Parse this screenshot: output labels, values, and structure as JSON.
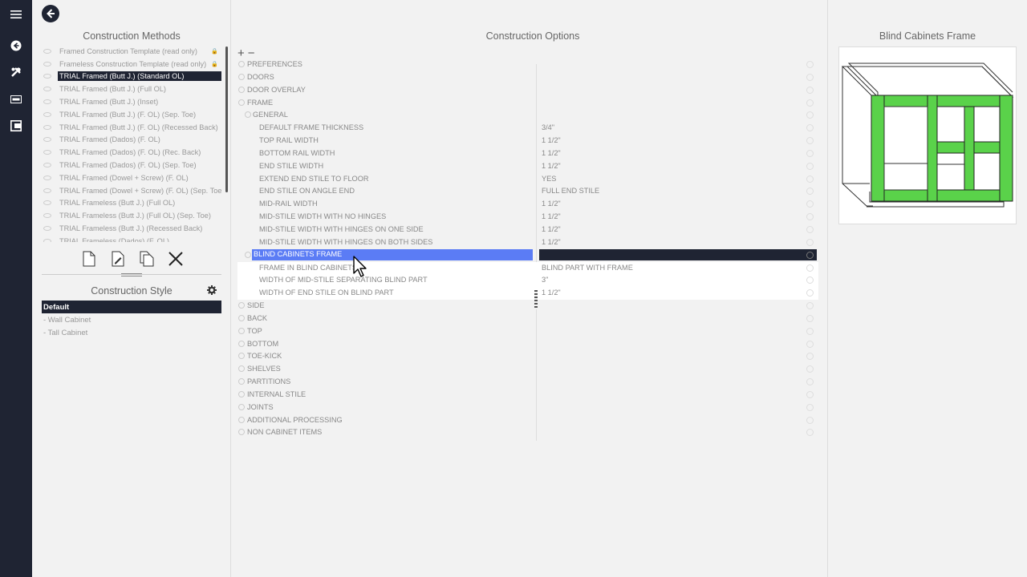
{
  "nav_rail": {
    "icons": [
      "menu-icon",
      "back-circle-icon",
      "tools-icon",
      "panel-icon",
      "cabinet-icon"
    ]
  },
  "left_panel": {
    "title": "Construction Methods",
    "methods": [
      {
        "label": "Framed Construction Template (read only)",
        "locked": true
      },
      {
        "label": "Frameless Construction Template (read only)",
        "locked": true
      },
      {
        "label": "TRIAL Framed (Butt J.) (Standard OL)",
        "selected": true
      },
      {
        "label": "TRIAL Framed (Butt J.) (Full OL)"
      },
      {
        "label": "TRIAL Framed (Butt J.) (Inset)"
      },
      {
        "label": "TRIAL Framed (Butt J.) (F. OL) (Sep. Toe)"
      },
      {
        "label": "TRIAL Framed (Butt J.) (F. OL) (Recessed Back)"
      },
      {
        "label": "TRIAL Framed (Dados) (F. OL)"
      },
      {
        "label": "TRIAL Framed (Dados) (F. OL) (Rec. Back)"
      },
      {
        "label": "TRIAL Framed (Dados) (F. OL) (Sep. Toe)"
      },
      {
        "label": "TRIAL Framed (Dowel + Screw) (F. OL)"
      },
      {
        "label": "TRIAL Framed (Dowel + Screw) (F. OL) (Sep. Toe)"
      },
      {
        "label": "TRIAL Frameless (Butt J.) (Full OL)"
      },
      {
        "label": "TRIAL Frameless (Butt J.) (Full OL) (Sep. Toe)"
      },
      {
        "label": "TRIAL Frameless (Butt J.) (Recessed Back)"
      },
      {
        "label": "TRIAL Frameless (Dados) (F. OL)"
      }
    ],
    "style_title": "Construction Style",
    "styles": [
      {
        "label": "Default",
        "selected": true
      },
      {
        "label": "- Wall Cabinet"
      },
      {
        "label": "- Tall Cabinet"
      }
    ]
  },
  "mid_panel": {
    "title": "Construction Options",
    "plus": "+",
    "minus": "−",
    "rows": [
      {
        "name": "PREFERENCES",
        "level": 0
      },
      {
        "name": "DOORS",
        "level": 0
      },
      {
        "name": "DOOR OVERLAY",
        "level": 0
      },
      {
        "name": "FRAME",
        "level": 0
      },
      {
        "name": "GENERAL",
        "level": 1
      },
      {
        "name": "DEFAULT FRAME THICKNESS",
        "level": 2,
        "value": "3/4\""
      },
      {
        "name": "TOP RAIL WIDTH",
        "level": 2,
        "value": "1 1/2\""
      },
      {
        "name": "BOTTOM RAIL WIDTH",
        "level": 2,
        "value": "1 1/2\""
      },
      {
        "name": "END STILE WIDTH",
        "level": 2,
        "value": "1 1/2\""
      },
      {
        "name": "EXTEND END STILE TO FLOOR",
        "level": 2,
        "value": "YES"
      },
      {
        "name": "END STILE ON ANGLE END",
        "level": 2,
        "value": "FULL END STILE"
      },
      {
        "name": "MID-RAIL WIDTH",
        "level": 2,
        "value": "1 1/2\""
      },
      {
        "name": "MID-STILE WIDTH WITH NO HINGES",
        "level": 2,
        "value": "1 1/2\""
      },
      {
        "name": "MID-STILE WIDTH WITH HINGES ON ONE SIDE",
        "level": 2,
        "value": "1 1/2\""
      },
      {
        "name": "MID-STILE WIDTH WITH HINGES ON BOTH SIDES",
        "level": 2,
        "value": "1 1/2\""
      },
      {
        "name": "BLIND CABINETS FRAME",
        "level": 1,
        "selected": true
      },
      {
        "name": "FRAME IN BLIND CABINETS",
        "level": 2,
        "value": "BLIND PART WITH FRAME",
        "white": true
      },
      {
        "name": "WIDTH OF MID-STILE SEPARATING BLIND PART",
        "level": 2,
        "value": "3\"",
        "white": true
      },
      {
        "name": "WIDTH OF END STILE ON BLIND PART",
        "level": 2,
        "value": "1 1/2\"",
        "white": true
      },
      {
        "name": "SIDE",
        "level": 0
      },
      {
        "name": "BACK",
        "level": 0
      },
      {
        "name": "TOP",
        "level": 0
      },
      {
        "name": "BOTTOM",
        "level": 0
      },
      {
        "name": "TOE-KICK",
        "level": 0
      },
      {
        "name": "SHELVES",
        "level": 0
      },
      {
        "name": "PARTITIONS",
        "level": 0
      },
      {
        "name": "INTERNAL STILE",
        "level": 0
      },
      {
        "name": "JOINTS",
        "level": 0
      },
      {
        "name": "ADDITIONAL PROCESSING",
        "level": 0
      },
      {
        "name": "NON CABINET ITEMS",
        "level": 0
      }
    ]
  },
  "right_panel": {
    "title": "Blind Cabinets Frame",
    "frame_color": "#5ad24a"
  }
}
